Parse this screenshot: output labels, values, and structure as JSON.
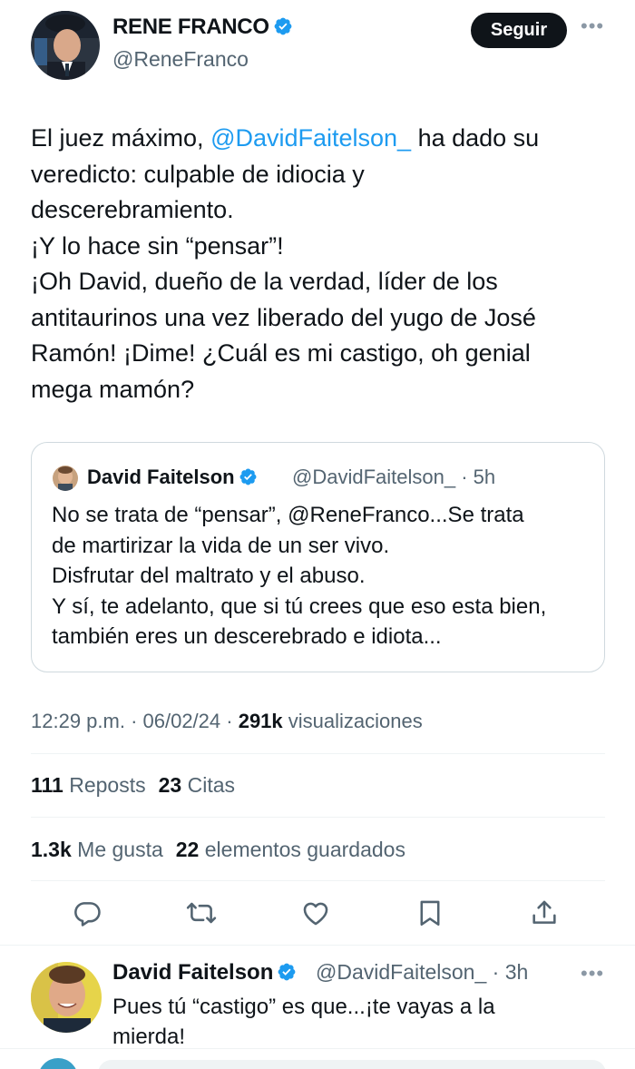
{
  "tweet": {
    "author_name": "RENE FRANCO",
    "author_handle": "@ReneFranco",
    "follow_label": "Seguir",
    "more_label": "•••",
    "text_lines": [
      {
        "pre": "El juez máximo, ",
        "mention": "@DavidFaitelson_",
        "post": " ha dado su"
      },
      "veredicto: culpable de idiocia y",
      "descerebramiento.",
      "¡Y lo hace sin “pensar”!",
      "¡Oh David, dueño de la verdad, líder de los",
      "antitaurinos una vez liberado del yugo de José",
      "Ramón! ¡Dime! ¿Cuál es mi castigo, oh genial",
      "mega mamón?"
    ],
    "time": "12:29 p.m. · 06/02/24 · ",
    "views_count": "291k",
    "views_label": " visualizaciones",
    "reposts_count": "111",
    "reposts_label": " Reposts",
    "quotes_count": "23",
    "quotes_label": " Citas",
    "likes_count": "1.3k",
    "likes_label": " Me gusta",
    "bookmarks_count": "22",
    "bookmarks_label": " elementos guardados"
  },
  "quote": {
    "author_name": "David Faitelson",
    "author_handle": "@DavidFaitelson_ · 5h",
    "text_lines": [
      "No se trata de “pensar”, @ReneFranco...Se trata",
      "de martirizar la vida de un ser vivo.",
      "Disfrutar del maltrato y el abuso.",
      "Y sí, te adelanto, que si tú crees que eso esta bien,",
      "también eres un descerebrado e idiota..."
    ]
  },
  "reply": {
    "author_name": "David Faitelson",
    "author_handle": "@DavidFaitelson_ · 3h",
    "more_label": "•••",
    "text_lines": [
      "Pues tú “castigo” es que...¡te vayas a la",
      "mierda!"
    ]
  },
  "icons": {
    "reply": "reply-icon",
    "repost": "repost-icon",
    "like": "heart-icon",
    "bookmark": "bookmark-icon",
    "share": "share-icon",
    "verified": "verified-badge-icon"
  },
  "colors": {
    "accent": "#1d9bf0",
    "text": "#0f1419",
    "muted": "#536471",
    "border": "#cfd9de"
  }
}
